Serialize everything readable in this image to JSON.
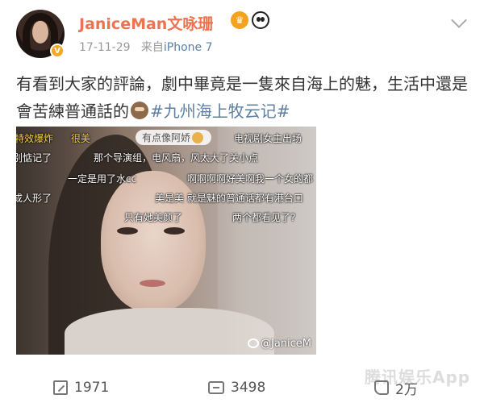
{
  "post": {
    "username": "JaniceMan文咏珊",
    "timestamp": "17-11-29",
    "source_prefix": "来自",
    "source_device": "iPhone 7",
    "text_main": "有看到大家的評論，劇中畢竟是一隻來自海上的魅，生活中還是會苦練普通話的",
    "hashtag": "#九州海上牧云记#",
    "icons": {
      "avatar": "avatar",
      "badge": "crown-badge-icon",
      "panda": "panda-icon",
      "expand": "chevron-down-icon",
      "emoji": "monkey-emoji-icon"
    }
  },
  "media": {
    "watermark": "@JaniceM",
    "danmaku": [
      "特效爆炸",
      "很美",
      "有点像阿娇",
      "电视剧女主出场",
      "别惦记了",
      "那个导演组，电风扇，风太大了关小点",
      "一定是用了水cc",
      "啊啊啊啊好美啊我一个女的都",
      "成人形了",
      "美是美 就是魅的普通话都有港台口",
      "只有她美颜了",
      "两个都看见了?"
    ]
  },
  "brand_watermark": "腾讯娱乐App",
  "actions": {
    "forward_count": "1971",
    "comment_count": "3498",
    "like_count": "2万"
  }
}
